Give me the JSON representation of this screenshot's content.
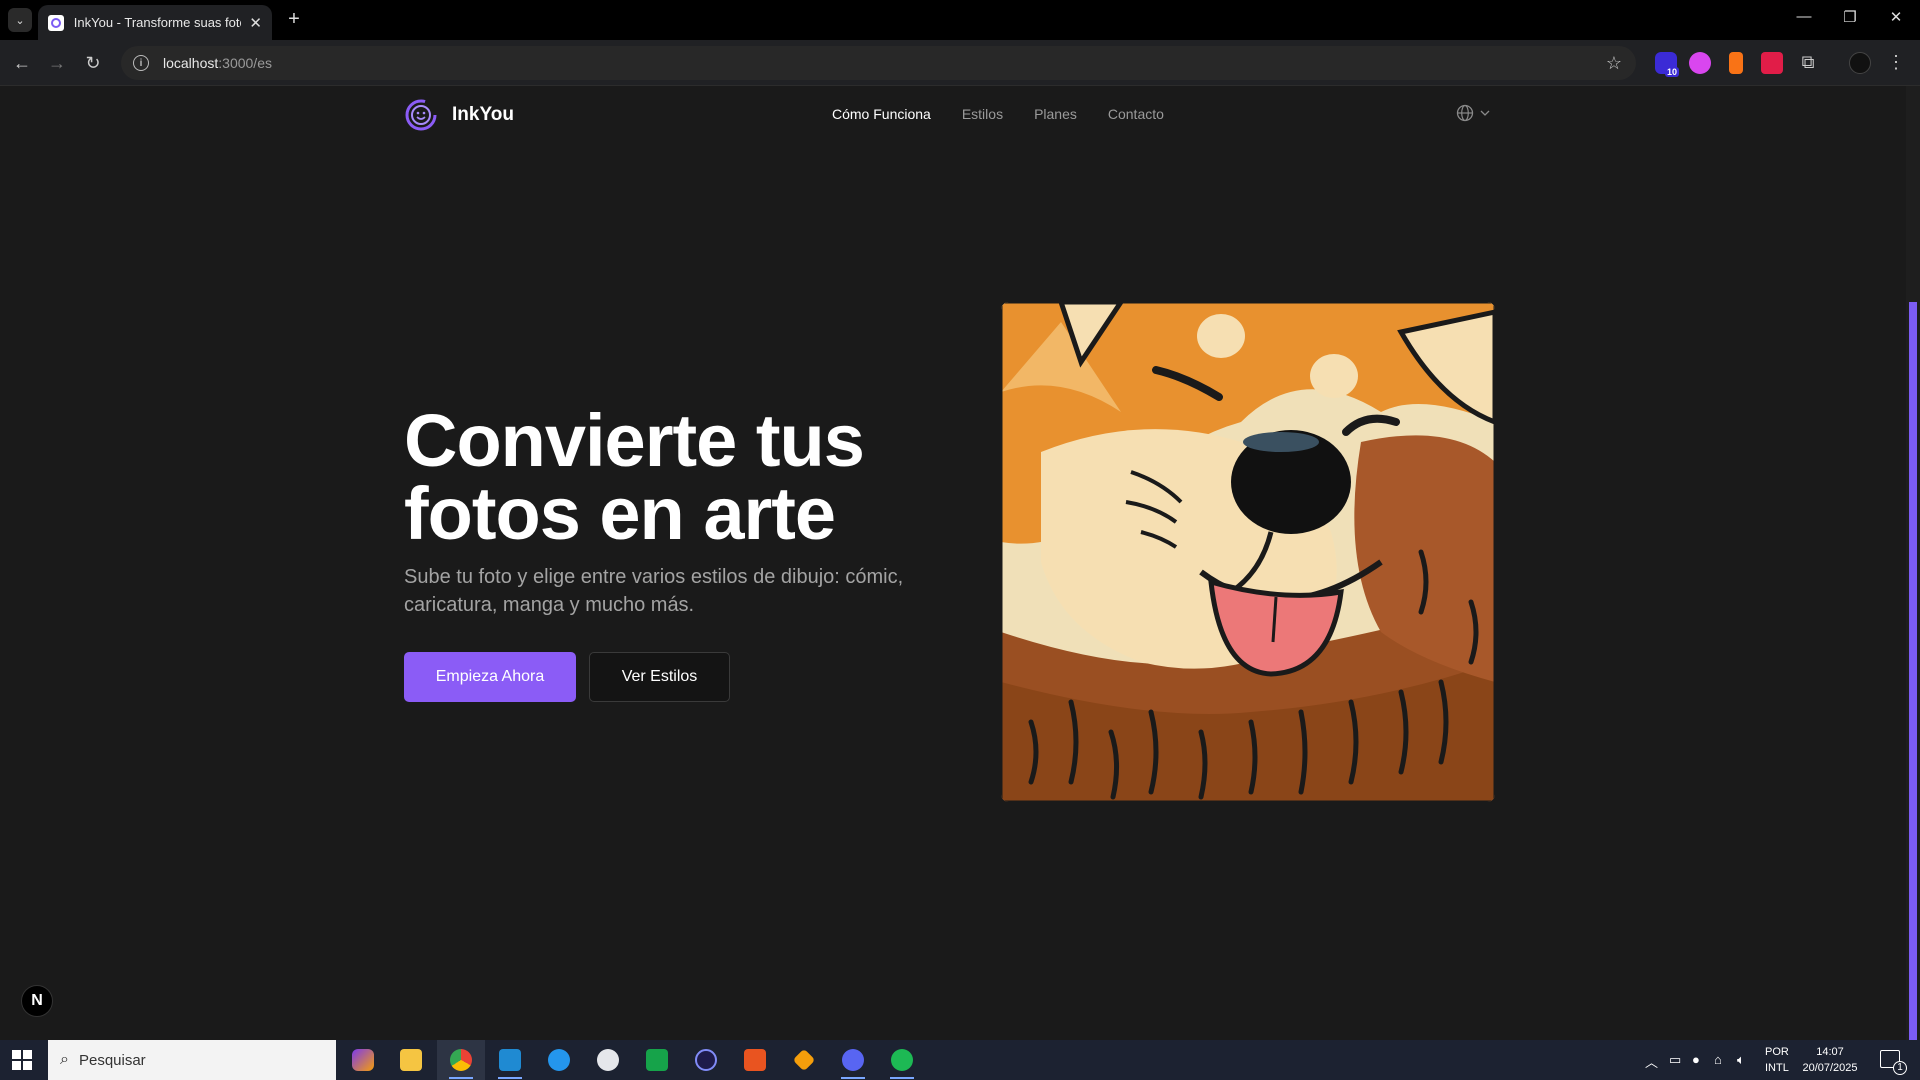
{
  "browser": {
    "tab_title": "InkYou - Transforme suas fotos",
    "url_host": "localhost",
    "url_path": ":3000/es",
    "extension_badge": "10"
  },
  "site": {
    "brand": "InkYou",
    "nav": [
      {
        "label": "Cómo Funciona",
        "active": true
      },
      {
        "label": "Estilos",
        "active": false
      },
      {
        "label": "Planes",
        "active": false
      },
      {
        "label": "Contacto",
        "active": false
      }
    ],
    "hero": {
      "title_line1": "Convierte tus",
      "title_line2": "fotos en arte",
      "subtitle": "Sube tu foto y elige entre varios estilos de dibujo: cómic, caricatura, manga y mucho más.",
      "primary_cta": "Empieza Ahora",
      "secondary_cta": "Ver Estilos"
    },
    "accent": "#8b5cf6",
    "next_badge": "N"
  },
  "taskbar": {
    "search_placeholder": "Pesquisar",
    "lang_top": "POR",
    "lang_bottom": "INTL",
    "time": "14:07",
    "date": "20/07/2025",
    "notification_count": "1"
  }
}
